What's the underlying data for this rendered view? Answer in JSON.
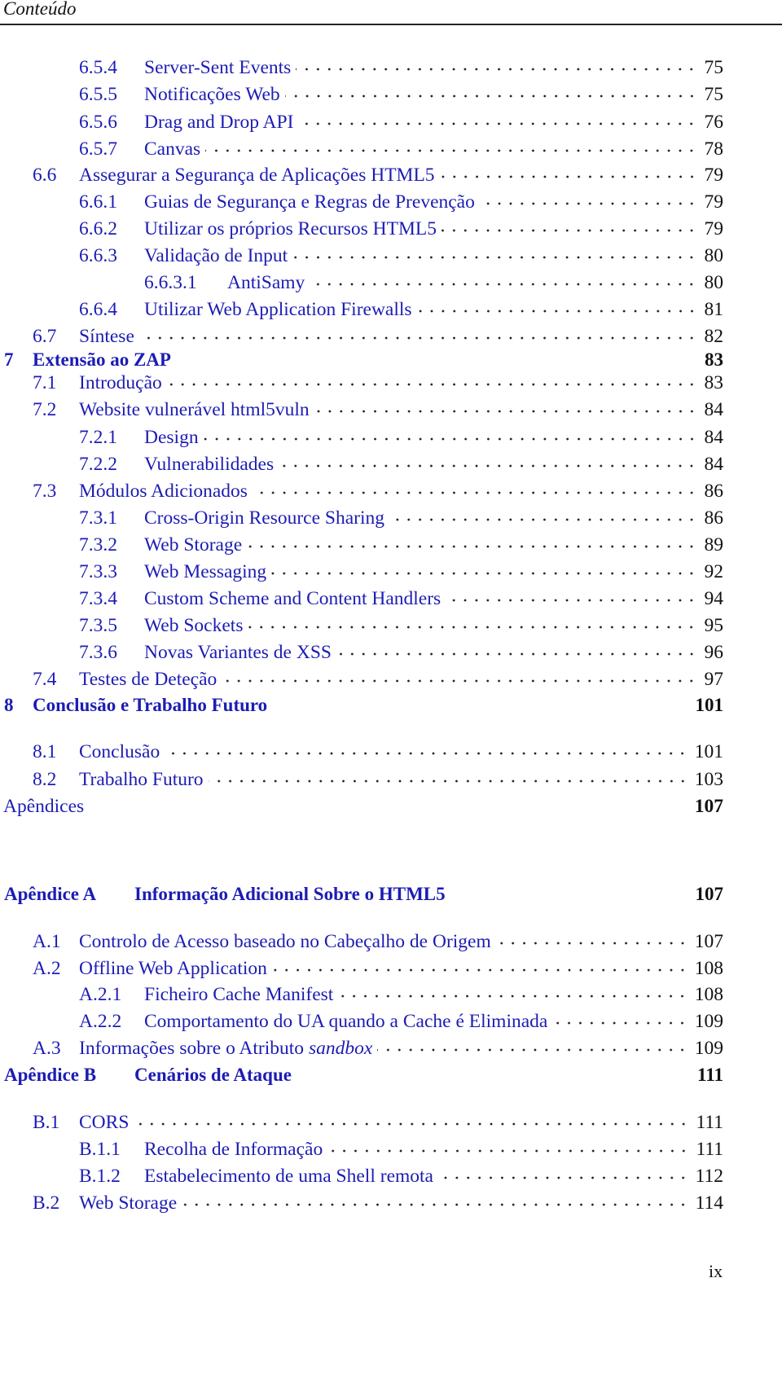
{
  "header": {
    "title": "Conteúdo"
  },
  "colors": {
    "link": "#1c1cb4",
    "page_number": "#111111"
  },
  "entries": [
    {
      "level": 3,
      "num": "6.5.4",
      "title": "Server-Sent Events",
      "page": "75"
    },
    {
      "level": 3,
      "num": "6.5.5",
      "title": "Notificações Web",
      "page": "75"
    },
    {
      "level": 3,
      "num": "6.5.6",
      "title": "Drag and Drop API",
      "page": "76"
    },
    {
      "level": 3,
      "num": "6.5.7",
      "title": "Canvas",
      "page": "78"
    },
    {
      "level": 2,
      "num": "6.6",
      "title": "Assegurar a Segurança de Aplicações HTML5",
      "page": "79"
    },
    {
      "level": 3,
      "num": "6.6.1",
      "title": "Guias de Segurança e Regras de Prevenção",
      "page": "79"
    },
    {
      "level": 3,
      "num": "6.6.2",
      "title": "Utilizar os próprios Recursos HTML5",
      "page": "79"
    },
    {
      "level": 3,
      "num": "6.6.3",
      "title": "Validação de Input",
      "page": "80"
    },
    {
      "level": 4,
      "num": "6.6.3.1",
      "title": "AntiSamy",
      "page": "80"
    },
    {
      "level": 3,
      "num": "6.6.4",
      "title": "Utilizar Web Application Firewalls",
      "page": "81"
    },
    {
      "level": 2,
      "num": "6.7",
      "title": "Síntese",
      "page": "82"
    },
    {
      "level": 1,
      "num": "7",
      "title": "Extensão ao ZAP",
      "page": "83"
    },
    {
      "level": 2,
      "num": "7.1",
      "title": "Introdução",
      "page": "83"
    },
    {
      "level": 2,
      "num": "7.2",
      "title": "Website vulnerável html5vuln",
      "page": "84"
    },
    {
      "level": 3,
      "num": "7.2.1",
      "title": "Design",
      "page": "84"
    },
    {
      "level": 3,
      "num": "7.2.2",
      "title": "Vulnerabilidades",
      "page": "84"
    },
    {
      "level": 2,
      "num": "7.3",
      "title": "Módulos Adicionados",
      "page": "86"
    },
    {
      "level": 3,
      "num": "7.3.1",
      "title": "Cross-Origin Resource Sharing",
      "page": "86"
    },
    {
      "level": 3,
      "num": "7.3.2",
      "title": "Web Storage",
      "page": "89"
    },
    {
      "level": 3,
      "num": "7.3.3",
      "title": "Web Messaging",
      "page": "92"
    },
    {
      "level": 3,
      "num": "7.3.4",
      "title": "Custom Scheme and Content Handlers",
      "page": "94"
    },
    {
      "level": 3,
      "num": "7.3.5",
      "title": "Web Sockets",
      "page": "95"
    },
    {
      "level": 3,
      "num": "7.3.6",
      "title": "Novas Variantes de XSS",
      "page": "96"
    },
    {
      "level": 2,
      "num": "7.4",
      "title": "Testes de Deteção",
      "page": "97"
    },
    {
      "level": 1,
      "num": "8",
      "title": "Conclusão e Trabalho Futuro",
      "page": "101"
    },
    {
      "level": 2,
      "num": "8.1",
      "title": "Conclusão",
      "page": "101"
    },
    {
      "level": 2,
      "num": "8.2",
      "title": "Trabalho Futuro",
      "page": "103"
    },
    {
      "level": 0,
      "num": "",
      "title": "Apêndices",
      "page": "107"
    },
    {
      "level": 1,
      "num": "Apêndice A",
      "title": "Informação Adicional Sobre o HTML5",
      "page": "107"
    },
    {
      "level": 2,
      "num": "A.1",
      "title": "Controlo de Acesso baseado no Cabeçalho de Origem",
      "page": "107"
    },
    {
      "level": 2,
      "num": "A.2",
      "title": "Offline Web Application",
      "page": "108"
    },
    {
      "level": 3,
      "num": "A.2.1",
      "title": "Ficheiro Cache Manifest",
      "page": "108"
    },
    {
      "level": 3,
      "num": "A.2.2",
      "title": "Comportamento do UA quando a Cache é Eliminada",
      "page": "109"
    },
    {
      "level": 2,
      "num": "A.3",
      "title": "Informações sobre o Atributo ",
      "title_em": "sandbox",
      "page": "109"
    },
    {
      "level": 1,
      "num": "Apêndice B",
      "title": "Cenários de Ataque",
      "page": "111"
    },
    {
      "level": 2,
      "num": "B.1",
      "title": "CORS",
      "page": "111"
    },
    {
      "level": 3,
      "num": "B.1.1",
      "title": "Recolha de Informação",
      "page": "111"
    },
    {
      "level": 3,
      "num": "B.1.2",
      "title": "Estabelecimento de uma Shell remota",
      "page": "112"
    },
    {
      "level": 2,
      "num": "B.2",
      "title": "Web Storage",
      "page": "114"
    }
  ],
  "footer": {
    "page_label": "ix"
  }
}
